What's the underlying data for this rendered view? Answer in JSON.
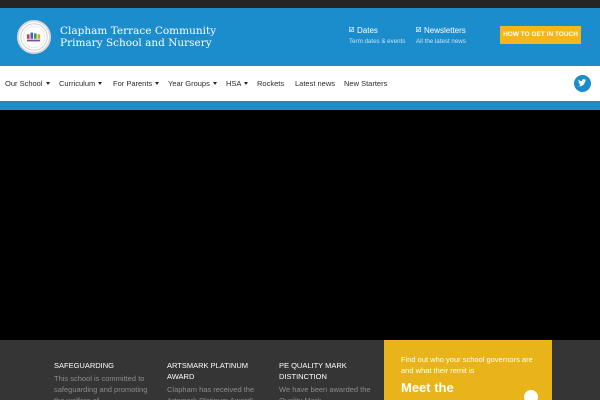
{
  "header": {
    "school_name_line1": "Clapham Terrace Community",
    "school_name_line2": "Primary School and Nursery",
    "quick_links": [
      {
        "title": "Dates",
        "subtitle": "Term dates & events",
        "icon": "check-icon"
      },
      {
        "title": "Newsletters",
        "subtitle": "All the latest news",
        "icon": "check-icon"
      }
    ],
    "cta_label": "HOW TO GET IN TOUCH"
  },
  "nav": {
    "items": [
      {
        "label": "Our School",
        "dropdown": true
      },
      {
        "label": "Curriculum",
        "dropdown": true
      },
      {
        "label": "For Parents",
        "dropdown": true
      },
      {
        "label": "Year Groups",
        "dropdown": true
      },
      {
        "label": "HSA",
        "dropdown": true
      },
      {
        "label": "Rockets",
        "dropdown": false
      },
      {
        "label": "Latest news",
        "dropdown": false
      },
      {
        "label": "New Starters",
        "dropdown": false
      }
    ],
    "social_icon": "twitter-icon"
  },
  "footer": {
    "columns": [
      {
        "title": "SAFEGUARDING",
        "body": "This school is committed to safeguarding and promoting the welfare of"
      },
      {
        "title": "ARTSMARK PLATINUM AWARD",
        "body": "Clapham has received the Artsmark Platinum Award!"
      },
      {
        "title": "PE QUALITY MARK DISTINCTION",
        "body": "We have been awarded the Quality Mark"
      }
    ],
    "governors": {
      "text": "Find out who your school governors are and what their remit is",
      "heading": "Meet the"
    }
  },
  "colors": {
    "brand_blue": "#1b8ccc",
    "accent_yellow": "#f5b51b",
    "governors_yellow": "#e8b419",
    "footer_dark": "#353535"
  }
}
